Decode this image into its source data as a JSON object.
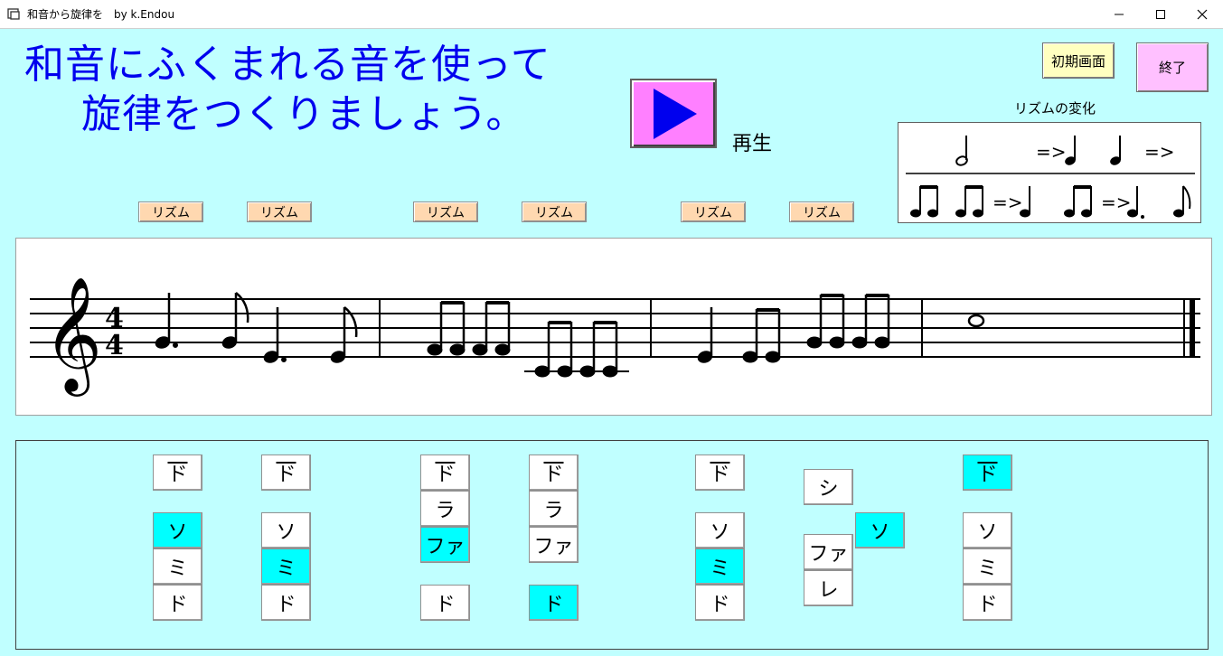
{
  "window": {
    "title": "和音から旋律を　by k.Endou"
  },
  "heading": {
    "line1": "和音にふくまれる音を使って",
    "line2": "旋律をつくりましょう。"
  },
  "play": {
    "label": "再生"
  },
  "buttons": {
    "initial": "初期画面",
    "end": "終了"
  },
  "rhythm_change": {
    "title": "リズムの変化",
    "arrow": "=>"
  },
  "rhythm_buttons": [
    "リズム",
    "リズム",
    "リズム",
    "リズム",
    "リズム",
    "リズム"
  ],
  "colors": {
    "background": "#c0ffff",
    "heading": "#0000ee",
    "selected": "#00ffff",
    "play_button": "#ff80ff",
    "initial_button": "#ffffc0",
    "end_button": "#ffc0ff",
    "rhythm_button": "#ffd8b0"
  },
  "score": {
    "clef": "treble-clef",
    "time_signature": "4/4",
    "measures": 4
  },
  "note_columns": [
    {
      "notes": [
        {
          "label": "ド",
          "high": true,
          "selected": false
        },
        {
          "label": "ソ",
          "selected": true
        },
        {
          "label": "ミ",
          "selected": false
        },
        {
          "label": "ド",
          "selected": false
        }
      ]
    },
    {
      "notes": [
        {
          "label": "ド",
          "high": true,
          "selected": false
        },
        {
          "label": "ソ",
          "selected": false
        },
        {
          "label": "ミ",
          "selected": true
        },
        {
          "label": "ド",
          "selected": false
        }
      ]
    },
    {
      "notes": [
        {
          "label": "ド",
          "high": true,
          "selected": false
        },
        {
          "label": "ラ",
          "selected": false
        },
        {
          "label": "ファ",
          "selected": true
        },
        {
          "label": "ド",
          "selected": false
        }
      ]
    },
    {
      "notes": [
        {
          "label": "ド",
          "high": true,
          "selected": false
        },
        {
          "label": "ラ",
          "selected": false
        },
        {
          "label": "ファ",
          "selected": false
        },
        {
          "label": "ド",
          "selected": true
        }
      ]
    },
    {
      "notes": [
        {
          "label": "ド",
          "high": true,
          "selected": false
        },
        {
          "label": "ソ",
          "selected": false
        },
        {
          "label": "ミ",
          "selected": true
        },
        {
          "label": "ド",
          "selected": false
        }
      ]
    },
    {
      "notes": [
        {
          "label": "シ",
          "selected": false
        },
        {
          "label": "ソ",
          "selected": true
        },
        {
          "label": "ファ",
          "selected": false
        },
        {
          "label": "レ",
          "selected": false
        }
      ]
    },
    {
      "notes": [
        {
          "label": "ド",
          "high": true,
          "selected": true
        },
        {
          "label": "ソ",
          "selected": false
        },
        {
          "label": "ミ",
          "selected": false
        },
        {
          "label": "ド",
          "selected": false
        }
      ]
    }
  ]
}
